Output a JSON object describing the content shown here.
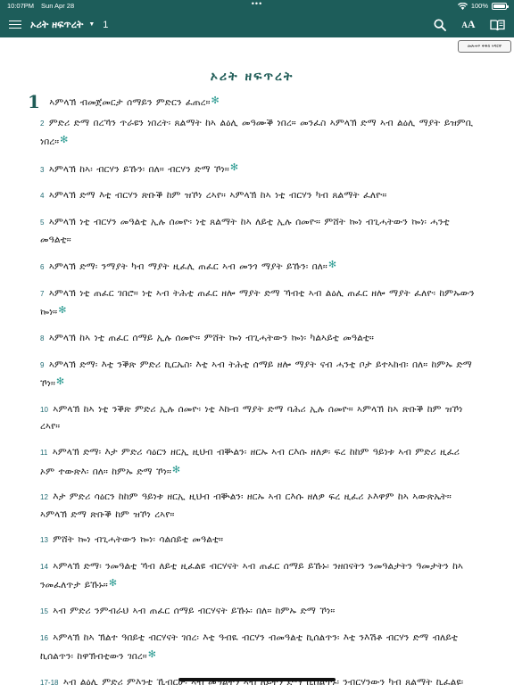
{
  "status_bar": {
    "time": "10:07PM",
    "date": "Sun Apr 28",
    "dots": "•••",
    "battery": "100%",
    "battery_level": 1.0
  },
  "nav": {
    "book_title": "ኦሪት ዘፍጥረት",
    "caret": "▼",
    "chapter": "1",
    "font_label": "A",
    "font_label_small": "A"
  },
  "compare_button": {
    "label": "መጽሐፍ ቅዱስ ትግርኛ"
  },
  "chapter_heading": "ኦሪት ዘፍጥረት",
  "verses": [
    {
      "num": "1",
      "text": "ኣምላኽ ብመጀመርታ ሰማይን ምድርን ፈጠረ።",
      "star": "✻"
    },
    {
      "num": "2",
      "text": "ምድሪ ድማ በረኻን ጥራዩን ነበረት፡ ጸልማት ከኣ ልዕሊ መዓሙቕ ነበረ። መንፈስ ኣምላኽ ድማ ኣብ ልዕሊ ማያት ይዝምቢ ነበረ።",
      "star": "✻"
    },
    {
      "num": "3",
      "text": "ኣምላኽ ከኣ፡ ብርሃን ይኹን፡ በለ። ብርሃን ድማ ኾነ።",
      "star": "✻"
    },
    {
      "num": "4",
      "text": "ኣምላኽ ድማ እቲ ብርሃን ጽቡቕ ከም ዝኾነ ረኣየ። ኣምላኽ ከኣ ነቲ ብርሃን ካብ ጸልማት ፈለዮ።",
      "star": ""
    },
    {
      "num": "5",
      "text": "ኣምላኽ ነቲ ብርሃን መዓልቲ ኢሉ ሰመዮ፡ ነቲ ጸልማት ከኣ ለይቲ ኢሉ ሰመዮ። ምሸት ኰነ ብጊሓትውን ኰነ፡ ሓንቲ መዓልቲ።",
      "star": ""
    },
    {
      "num": "6",
      "text": "ኣምላኽ ድማ፡ ንማያት ካብ ማያት ዚፈሊ ጠፈር ኣብ መንጎ ማያት ይኹን፡ በለ።",
      "star": "✻"
    },
    {
      "num": "7",
      "text": "ኣምላኽ ነቲ ጠፈር ገበሮ። ነቲ ኣብ ትሕቲ ጠፈር ዘሎ ማያት ድማ ኻብቲ ኣብ ልዕሊ ጠፈር ዘሎ ማያት ፈለዮ፡ ከምኡውን ኰነ።",
      "star": "✻"
    },
    {
      "num": "8",
      "text": "ኣምላኽ ከኣ ነቲ ጠፈር ሰማይ ኢሉ ሰመዮ። ምሸት ኰነ ብጊሓትውን ኰነ፡ ካልኣይቲ መዓልቲ።",
      "star": ""
    },
    {
      "num": "9",
      "text": "ኣምላኽ ድማ፡ እቲ ንቕጽ ምድሪ ኪርኤስ፡ እቲ ኣብ ትሕቲ ሰማይ ዘሎ ማያት ናብ ሓንቲ ቦታ ይተኣከብ፡ በለ። ከምኡ ድማ ኾነ።",
      "star": "✻"
    },
    {
      "num": "10",
      "text": "ኣምላኽ ከኣ ነቲ ንቕጽ ምድሪ ኢሉ ሰመዮ፡ ነቲ እኩብ ማያት ድማ ባሕሪ ኢሉ ሰመዮ። ኣምላኽ ከኣ ጽቡቕ ከም ዝኾነ ረኣየ።",
      "star": ""
    },
    {
      "num": "11",
      "text": "ኣምላኽ ድማ፡ እታ ምድሪ ሳዕርን ዘርኢ ዚህብ ብቝልን፡ ዘርኡ ኣብ ርእሱ ዘለዎ፡ ፍረ ከከም ዓይነቱ ኣብ ምድሪ ዚፈሪ ኦም ተውጽእ፡ በለ። ከምኡ ድማ ኾነ።",
      "star": "✻"
    },
    {
      "num": "12",
      "text": "እታ ምድሪ ሳዕርን ከከም ዓይነቱ ዘርኢ ዚህብ ብቝልን፡ ዘርኡ ኣብ ርእሱ ዘለዎ ፍረ ዚፈሪ ኦእዋም ከኣ ኣውጽኤት። ኣምላኽ ድማ ጽቡቕ ከም ዝኾነ ረኣየ።",
      "star": ""
    },
    {
      "num": "13",
      "text": "ምሸት ኰነ ብጊሓትውን ኰነ፡ ሳልሰይቲ መዓልቲ።",
      "star": ""
    },
    {
      "num": "14",
      "text": "ኣምላኽ ድማ፡ ንመዓልቲ ኻብ ለይቲ ዚፈልዩ ብርሃናት ኣብ ጠፈር ሰማይ ይኹኑ፡ ንዘበናትን ንመዓልታትን ዓመታትን ከኣ ንመፈለጥታ ይኹኑ።",
      "star": "✻"
    },
    {
      "num": "15",
      "text": "ኣብ ምድሪ ንምብራህ ኣብ ጠፈር ሰማይ ብርሃናት ይኹኑ፡ በለ። ከምኡ ድማ ኾነ።",
      "star": ""
    },
    {
      "num": "16",
      "text": "ኣምላኽ ከኣ ኽልተ ዓበይቲ ብርሃናት ገበረ፡ እቲ ዓብዪ ብርሃን ብመዓልቲ ኪሰልጥን፡ እቲ ንእሽቶ ብርሃን ድማ ብለይቲ ኪሰልጥን፡ ከዋኽብቲውን ገበረ።",
      "star": "✻"
    },
    {
      "num": "17-18",
      "text": "ኣብ ልዕሊ ምድሪ ምእንቲ ኺብርሁ፡ ኣብ መዓልትን ኣብ ለይትን ድማ ኪሰልጥኑ፡ ንብርሃንውን ካብ ጸልማት ኪፈልዩ፡ ኣምላኽ ኣብ ጠፈር ሰማይ ገበሮም። ኣምላኽ ድማ ጽቡቕ ከም ዝኾነ ረኣየ።",
      "star": "✻"
    }
  ],
  "colors": {
    "nav_bg": "#1d5d5a",
    "heading": "#1f5c57",
    "verse_num": "#1f6a73",
    "star": "#2e9c93"
  },
  "icons": {
    "menu": "menu-icon",
    "search": "search-icon",
    "font": "font-size-icon",
    "reader": "book-icon"
  }
}
